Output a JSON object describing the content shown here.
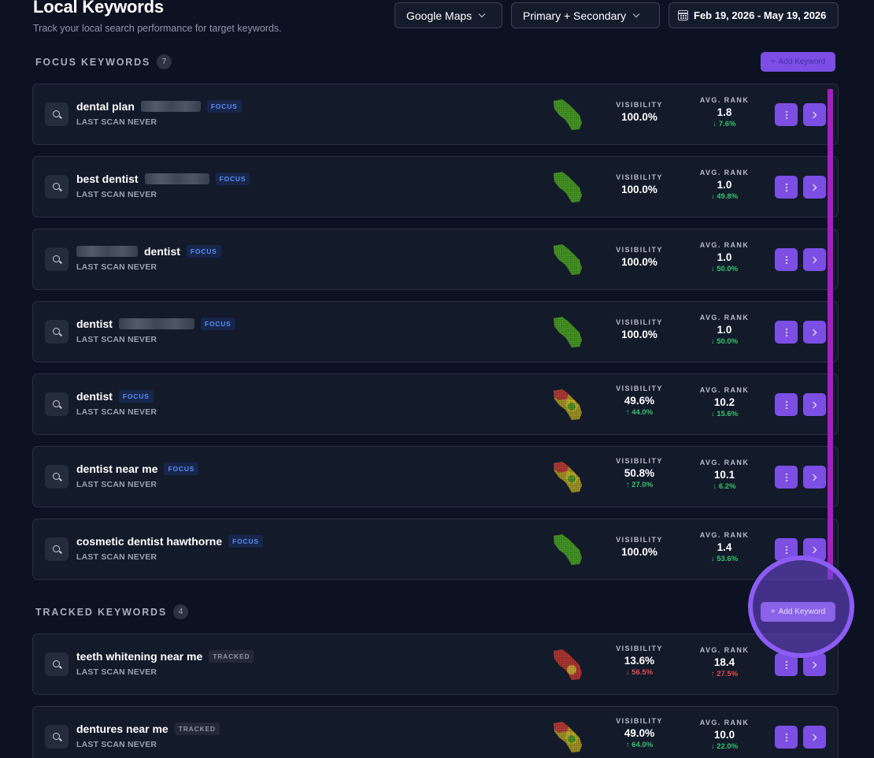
{
  "header": {
    "title": "Local Keywords",
    "subtitle": "Track your local search performance for target keywords.",
    "engine_select": "Google Maps",
    "results_select": "Primary + Secondary",
    "date_range": "Feb 19, 2026 - May 19, 2026"
  },
  "focus_section": {
    "title": "FOCUS KEYWORDS",
    "count": "7",
    "add_label": "Add Keyword"
  },
  "tracked_section": {
    "title": "TRACKED KEYWORDS",
    "count": "4",
    "add_label": "Add Keyword"
  },
  "labels": {
    "visibility": "VISIBILITY",
    "avg_rank": "AVG. RANK"
  },
  "focus_keywords": [
    {
      "pre": "",
      "keyword": "dental plan",
      "post": "",
      "tag": "FOCUS",
      "scan": "LAST SCAN NEVER",
      "visibility": "100.0%",
      "visibility_change": "",
      "rank": "1.8",
      "rank_change": "↓ 7.6%",
      "heatmap": "green"
    },
    {
      "pre": "",
      "keyword": "best dentist",
      "post": "",
      "tag": "FOCUS",
      "scan": "LAST SCAN NEVER",
      "visibility": "100.0%",
      "visibility_change": "",
      "rank": "1.0",
      "rank_change": "↓ 49.8%",
      "heatmap": "green"
    },
    {
      "pre": "",
      "keyword": "dentist",
      "post": "",
      "tag": "FOCUS",
      "scan": "LAST SCAN NEVER",
      "visibility": "100.0%",
      "visibility_change": "",
      "rank": "1.0",
      "rank_change": "↓ 50.0%",
      "heatmap": "green"
    },
    {
      "pre": "",
      "keyword": "dentist",
      "post": "",
      "tag": "FOCUS",
      "scan": "LAST SCAN NEVER",
      "visibility": "100.0%",
      "visibility_change": "",
      "rank": "1.0",
      "rank_change": "↓ 50.0%",
      "heatmap": "green"
    },
    {
      "pre": "",
      "keyword": "dentist",
      "post": "",
      "tag": "FOCUS",
      "scan": "LAST SCAN NEVER",
      "visibility": "49.6%",
      "visibility_change": "↑ 44.0%",
      "rank": "10.2",
      "rank_change": "↓ 15.6%",
      "heatmap": "mixed"
    },
    {
      "pre": "",
      "keyword": "dentist near me",
      "post": "",
      "tag": "FOCUS",
      "scan": "LAST SCAN NEVER",
      "visibility": "50.8%",
      "visibility_change": "↑ 27.0%",
      "rank": "10.1",
      "rank_change": "↓ 6.2%",
      "heatmap": "mixed"
    },
    {
      "pre": "",
      "keyword": "cosmetic dentist hawthorne",
      "post": "",
      "tag": "FOCUS",
      "scan": "LAST SCAN NEVER",
      "visibility": "100.0%",
      "visibility_change": "",
      "rank": "1.4",
      "rank_change": "↓ 53.6%",
      "heatmap": "green"
    }
  ],
  "tracked_keywords": [
    {
      "keyword": "teeth whitening near me",
      "tag": "TRACKED",
      "scan": "LAST SCAN NEVER",
      "visibility": "13.6%",
      "visibility_change": "↓ 56.5%",
      "rank": "18.4",
      "rank_change": "↑ 27.5%",
      "heatmap": "red"
    },
    {
      "keyword": "dentures near me",
      "tag": "TRACKED",
      "scan": "LAST SCAN NEVER",
      "visibility": "49.0%",
      "visibility_change": "↑ 64.0%",
      "rank": "10.0",
      "rank_change": "↓ 22.0%",
      "heatmap": "mixed"
    }
  ],
  "colors": {
    "accent": "#7c4ee4",
    "positive": "#36c46f",
    "negative": "#e34c4c",
    "focus_tag": "#5b8df5",
    "scrollbar": "#a61dc3"
  }
}
